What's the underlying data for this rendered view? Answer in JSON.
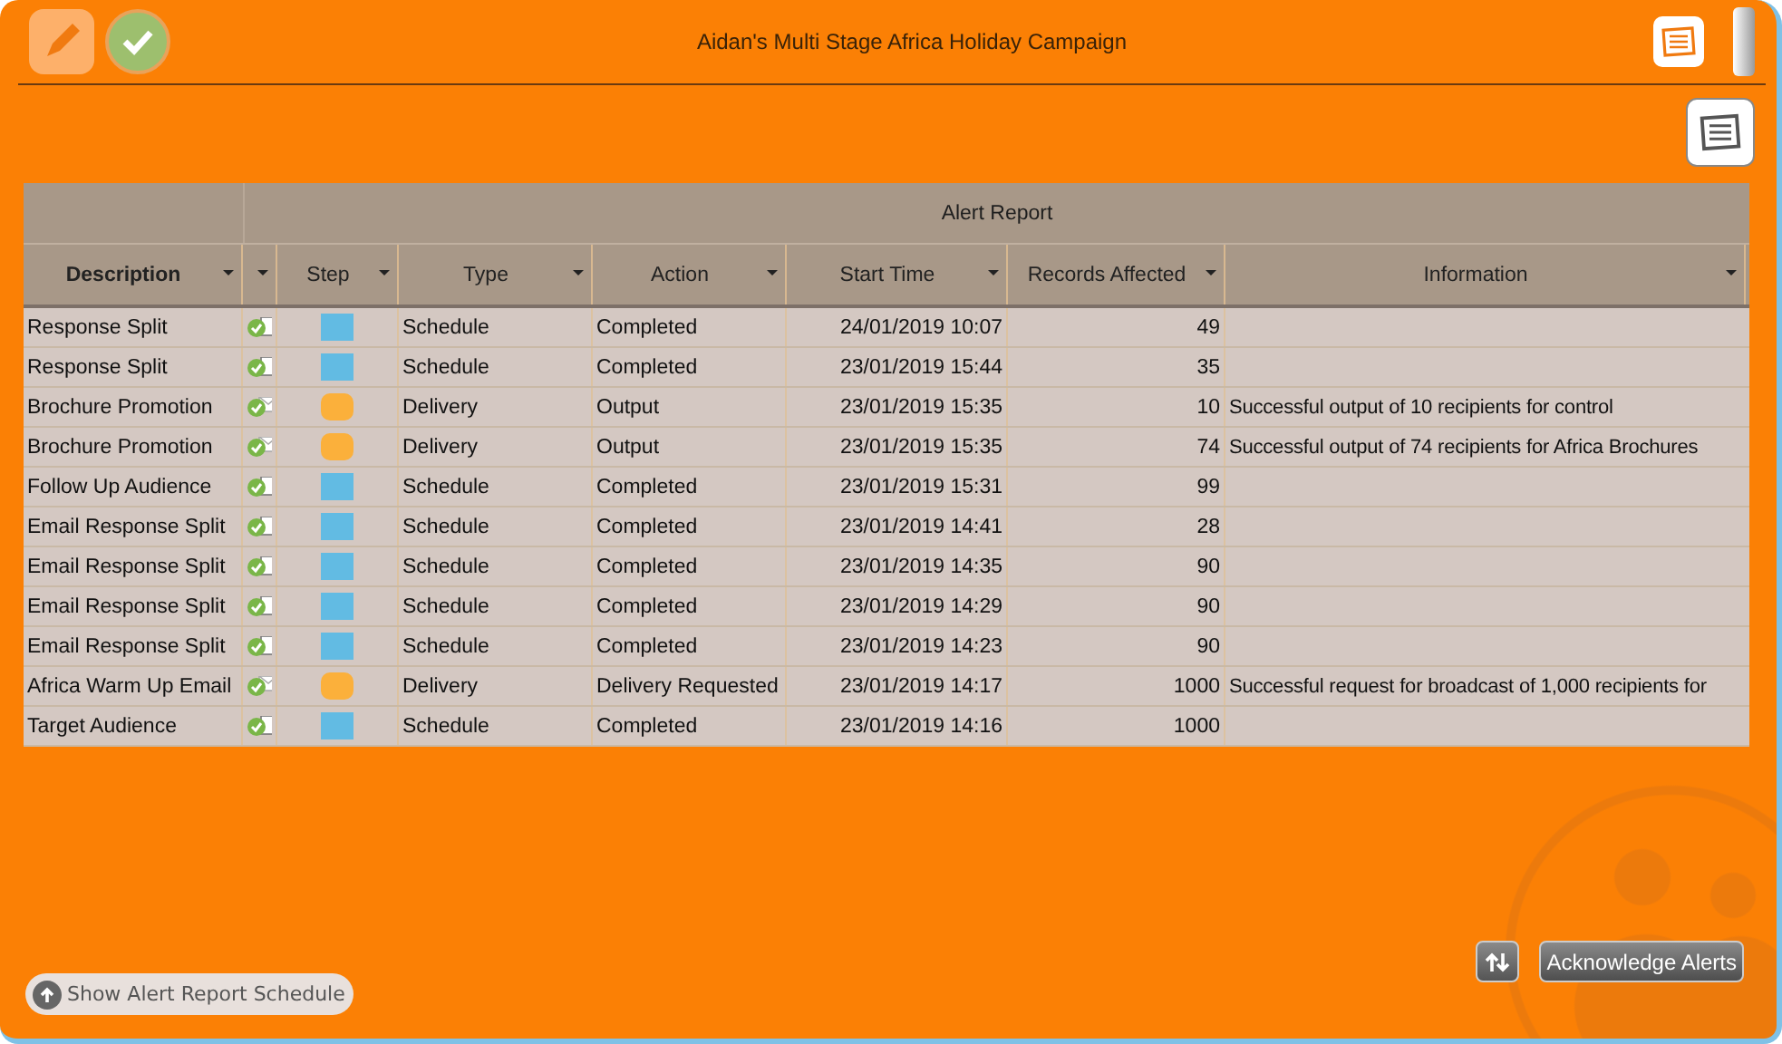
{
  "window": {
    "title": "Aidan's Multi Stage Africa Holiday Campaign"
  },
  "table": {
    "group_header": "Alert Report",
    "columns": [
      {
        "label": "Description",
        "bold": true
      },
      {},
      {
        "label": "Step"
      },
      {
        "label": "Type"
      },
      {
        "label": "Action"
      },
      {
        "label": "Start Time"
      },
      {
        "label": "Records Affected"
      },
      {
        "label": "Information"
      }
    ],
    "rows": [
      {
        "description": "Response Split",
        "kind": "schedule",
        "type": "Schedule",
        "action": "Completed",
        "start_time": "24/01/2019 10:07",
        "records": "49"
      },
      {
        "description": "Response Split",
        "kind": "schedule",
        "type": "Schedule",
        "action": "Completed",
        "start_time": "23/01/2019 15:44",
        "records": "35"
      },
      {
        "description": "Brochure Promotion",
        "kind": "delivery",
        "type": "Delivery",
        "action": "Output",
        "start_time": "23/01/2019 15:35",
        "records": "10",
        "information": "Successful output of 10 recipients for control"
      },
      {
        "description": "Brochure Promotion",
        "kind": "delivery",
        "type": "Delivery",
        "action": "Output",
        "start_time": "23/01/2019 15:35",
        "records": "74",
        "information": "Successful output of 74 recipients for Africa Brochures"
      },
      {
        "description": "Follow Up Audience",
        "kind": "schedule",
        "type": "Schedule",
        "action": "Completed",
        "start_time": "23/01/2019 15:31",
        "records": "99"
      },
      {
        "description": "Email Response Split",
        "kind": "schedule",
        "type": "Schedule",
        "action": "Completed",
        "start_time": "23/01/2019 14:41",
        "records": "28"
      },
      {
        "description": "Email Response Split",
        "kind": "schedule",
        "type": "Schedule",
        "action": "Completed",
        "start_time": "23/01/2019 14:35",
        "records": "90"
      },
      {
        "description": "Email Response Split",
        "kind": "schedule",
        "type": "Schedule",
        "action": "Completed",
        "start_time": "23/01/2019 14:29",
        "records": "90"
      },
      {
        "description": "Email Response Split",
        "kind": "schedule",
        "type": "Schedule",
        "action": "Completed",
        "start_time": "23/01/2019 14:23",
        "records": "90"
      },
      {
        "description": "Africa Warm Up Email",
        "kind": "delivery",
        "type": "Delivery",
        "action": "Delivery Requested",
        "start_time": "23/01/2019 14:17",
        "records": "1000",
        "information": "Successful request for broadcast of 1,000 recipients for"
      },
      {
        "description": "Target Audience",
        "kind": "schedule",
        "type": "Schedule",
        "action": "Completed",
        "start_time": "23/01/2019 14:16",
        "records": "1000"
      }
    ]
  },
  "buttons": {
    "acknowledge": "Acknowledge Alerts",
    "show_schedule": "Show Alert Report Schedule"
  }
}
